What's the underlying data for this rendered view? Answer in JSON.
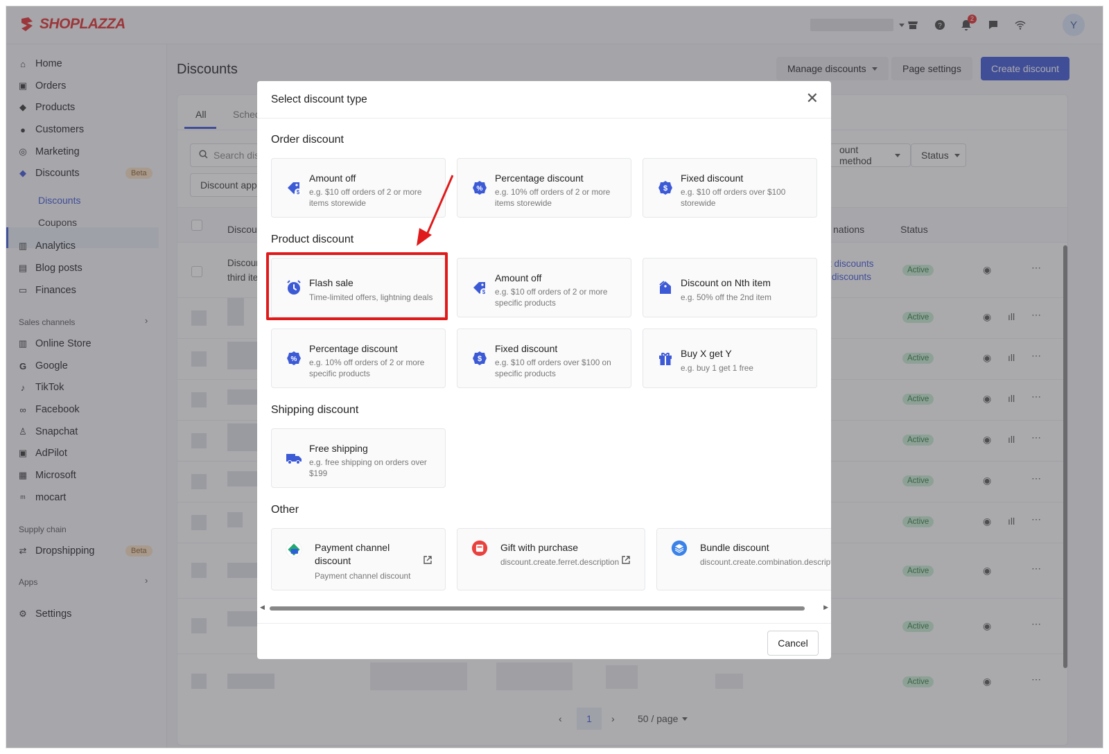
{
  "brand": {
    "name": "SHOPLAZZA",
    "color": "#e02b2b",
    "accent": "#3b52d4"
  },
  "topbar": {
    "notification_count": "2",
    "avatar_initial": "Y"
  },
  "sidebar": {
    "items": [
      {
        "label": "Home",
        "icon": "home-icon"
      },
      {
        "label": "Orders",
        "icon": "orders-icon"
      },
      {
        "label": "Products",
        "icon": "tag-icon"
      },
      {
        "label": "Customers",
        "icon": "person-icon"
      },
      {
        "label": "Marketing",
        "icon": "marketing-icon"
      },
      {
        "label": "Discounts",
        "icon": "discount-icon",
        "badge": "Beta"
      }
    ],
    "sub_items": [
      "Discounts",
      "Coupons"
    ],
    "items2": [
      {
        "label": "Analytics",
        "icon": "bar-chart-icon"
      },
      {
        "label": "Blog posts",
        "icon": "blog-icon"
      },
      {
        "label": "Finances",
        "icon": "finance-icon"
      }
    ],
    "sales_channels_label": "Sales channels",
    "channels": [
      "Online Store",
      "Google",
      "TikTok",
      "Facebook",
      "Snapchat",
      "AdPilot",
      "Microsoft",
      "mocart"
    ],
    "supply_chain_label": "Supply chain",
    "dropshipping": {
      "label": "Dropshipping",
      "badge": "Beta"
    },
    "apps_label": "Apps",
    "settings_label": "Settings"
  },
  "page": {
    "title": "Discounts",
    "manage_label": "Manage discounts",
    "page_settings_label": "Page settings",
    "create_label": "Create discount"
  },
  "list": {
    "tabs": [
      "All",
      "Sched"
    ],
    "search_placeholder": "Search disc",
    "filter_applies": "Discount appl",
    "filter_method": "ount method",
    "filter_status": "Status",
    "col_discount": "Discou",
    "col_combinations": "nations",
    "col_status": "Status",
    "first_row_name": "Discoun",
    "first_row_sub": "third ite",
    "first_row_link1": "t discounts",
    "first_row_link2": "discounts",
    "status_active": "Active",
    "pager_page": "1",
    "pager_size": "50 / page"
  },
  "modal": {
    "title": "Select discount type",
    "sections": {
      "order": "Order discount",
      "product": "Product discount",
      "shipping": "Shipping discount",
      "other": "Other"
    },
    "order_options": [
      {
        "title": "Amount off",
        "desc": "e.g. $10 off orders of 2 or more items storewide",
        "icon": "price-tag-dollar-icon"
      },
      {
        "title": "Percentage discount",
        "desc": "e.g. 10% off orders of 2 or more items storewide",
        "icon": "percent-badge-icon"
      },
      {
        "title": "Fixed discount",
        "desc": "e.g. $10 off orders over $100 storewide",
        "icon": "dollar-badge-icon"
      }
    ],
    "product_options": [
      {
        "title": "Flash sale",
        "desc": "Time-limited offers, lightning deals",
        "icon": "alarm-clock-icon"
      },
      {
        "title": "Amount off",
        "desc": "e.g. $10 off orders of 2 or more specific products",
        "icon": "price-tag-dollar-icon"
      },
      {
        "title": "Discount on Nth item",
        "desc": "e.g. 50% off the 2nd item",
        "icon": "nth-item-tag-icon"
      },
      {
        "title": "Percentage discount",
        "desc": "e.g. 10% off orders of 2 or more specific products",
        "icon": "percent-badge-icon"
      },
      {
        "title": "Fixed discount",
        "desc": "e.g. $10 off orders over $100 on specific products",
        "icon": "dollar-badge-icon"
      },
      {
        "title": "Buy X get Y",
        "desc": "e.g. buy 1 get 1 free",
        "icon": "gift-icon"
      }
    ],
    "shipping_options": [
      {
        "title": "Free shipping",
        "desc": "e.g. free shipping on orders over $199",
        "icon": "truck-icon"
      }
    ],
    "other_options": [
      {
        "title": "Payment channel discount",
        "desc": "Payment channel discount",
        "icon": "payment-channel-icon"
      },
      {
        "title": "Gift with purchase",
        "desc": "discount.create.ferret.description",
        "icon": "gift-purchase-icon"
      },
      {
        "title": "Bundle discount",
        "desc": "discount.create.combination.description",
        "icon": "bundle-icon"
      }
    ],
    "cancel_label": "Cancel"
  },
  "highlight": {
    "color": "#e01a1a",
    "target": "Flash sale"
  }
}
